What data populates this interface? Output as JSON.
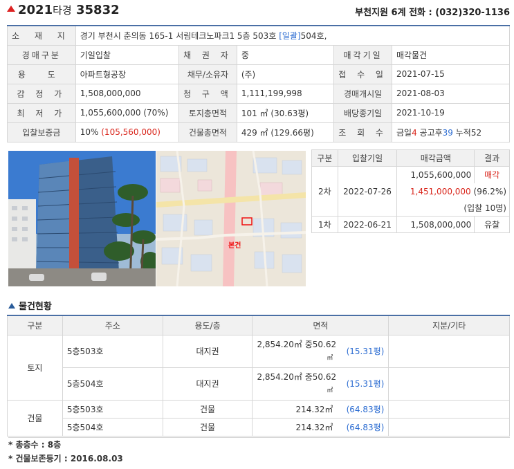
{
  "header": {
    "year": "2021",
    "kind": "타경",
    "number": "35832",
    "court": "부천지원 6계",
    "phone_label": "전화 :",
    "phone": "(032)320-1136"
  },
  "info": {
    "address_label": "소 재 지",
    "address": "경기 부천시 춘의동 165-1 서림테크노파크1 5층 503호",
    "address_link": "[일괄]",
    "address_tail": "504호,",
    "rows": [
      {
        "l1": "경매구분",
        "v1": "기일입찰",
        "l2": "채 권 자",
        "v2": "중",
        "l3": "매각기일",
        "v3": "매각물건"
      },
      {
        "l1": "용 도",
        "v1": "아파트형공장",
        "l2": "채무/소유자",
        "v2": "(주)",
        "l3": "접 수 일",
        "v3": "2021-07-15"
      },
      {
        "l1": "감 정 가",
        "v1": "1,508,000,000",
        "l2": "청 구 액",
        "v2": "1,111,199,998",
        "l3": "경매개시일",
        "v3": "2021-08-03"
      },
      {
        "l1": "최 저 가",
        "v1": "1,055,600,000 (70%)",
        "l2": "토지총면적",
        "v2": "101 ㎡ (30.63평)",
        "l3": "배당종기일",
        "v3": "2021-10-19"
      }
    ],
    "deposit_label": "입찰보증금",
    "deposit_pct": "10%",
    "deposit_amount": "(105,560,000)",
    "building_area_label": "건물총면적",
    "building_area": "429 ㎡ (129.66평)",
    "views_label": "조 회 수",
    "views_today_label": "금일",
    "views_today": "4",
    "views_after_label": "공고후",
    "views_after": "39",
    "views_total_label": "누적",
    "views_total": "52"
  },
  "map": {
    "marker_label": "본건"
  },
  "bids": {
    "headers": [
      "구분",
      "입찰기일",
      "매각금액",
      "결과"
    ],
    "round2": {
      "label": "2차",
      "date": "2022-07-26",
      "min_price": "1,055,600,000",
      "result": "매각",
      "sale_price": "1,451,000,000",
      "sale_pct": "(96.2%)",
      "bidders": "(입찰 10명)"
    },
    "round1": {
      "label": "1차",
      "date": "2022-06-21",
      "price": "1,508,000,000",
      "result": "유찰"
    }
  },
  "status": {
    "section_title": "물건현황",
    "headers": [
      "구분",
      "주소",
      "용도/층",
      "면적",
      "지분/기타"
    ],
    "land_label": "토지",
    "building_label": "건물",
    "land_rows": [
      {
        "addr": "5층503호",
        "use": "대지권",
        "area": "2,854.20㎡ 중50.62",
        "unit": "㎡",
        "pyeong": "(15.31평)"
      },
      {
        "addr": "5층504호",
        "use": "대지권",
        "area": "2,854.20㎡ 중50.62",
        "unit": "㎡",
        "pyeong": "(15.31평)"
      }
    ],
    "building_rows": [
      {
        "addr": "5층503호",
        "use": "건물",
        "area": "214.32㎡",
        "pyeong": "(64.83평)"
      },
      {
        "addr": "5층504호",
        "use": "건물",
        "area": "214.32㎡",
        "pyeong": "(64.83평)"
      }
    ]
  },
  "notes": [
    "* 총층수 : 8층",
    "* 건물보존등기 : 2016.08.03"
  ],
  "colors": {
    "accent_red": "#d9261c",
    "link_blue": "#2a6bd1",
    "table_border_top": "#4a6fa5",
    "label_bg": "#f1f1f1"
  }
}
